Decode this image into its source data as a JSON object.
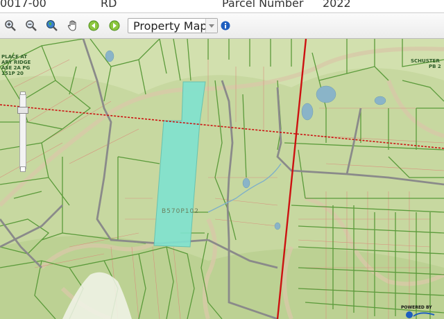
{
  "info": {
    "account": "0017-00",
    "road": "RD",
    "parcel_label": "Parcel Number",
    "year": "2022"
  },
  "toolbar": {
    "layer_select": "Property Map",
    "tools": [
      "zoom-in-icon",
      "zoom-out-icon",
      "globe-icon",
      "pan-hand-icon",
      "back-icon",
      "forward-icon"
    ],
    "info_icon": "info-icon"
  },
  "map": {
    "labels": {
      "nw_line1": "PLACE AT",
      "nw_line2": "ARY RIDGE",
      "nw_line3": "ASE 2A PG",
      "nw_line4": "151P 20",
      "ne_line1": "SCHUSTER",
      "ne_line2": "PB 2",
      "parcel_id": "B570P102"
    },
    "colors": {
      "parcel_highlight": "#7fe3d0",
      "parcel_line": "#5a9a3a",
      "road_red": "#cc1111",
      "boundary": "#8a8a8a"
    },
    "powered_by": "POWERED BY"
  }
}
